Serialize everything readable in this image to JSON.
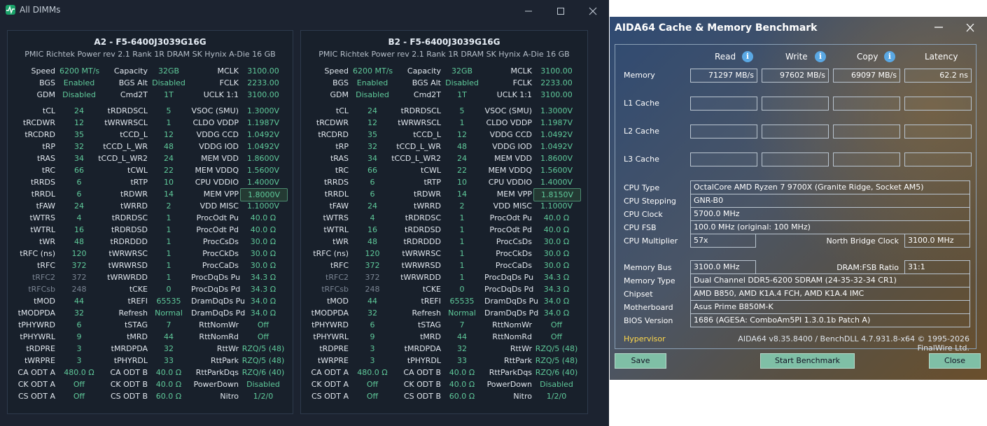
{
  "dimm_window": {
    "title": "All DIMMs",
    "controls": {
      "minimize": "—",
      "maximize": "☐",
      "close": "✕"
    },
    "panels": [
      {
        "title": "A2  -  F5-6400J3039G16G",
        "subtitle": "PMIC Richtek Power rev 2.1    Rank 1R    DRAM SK Hynix A-Die    16 GB",
        "rows": [
          [
            "Speed",
            "6200 MT/s",
            "Capacity",
            "32GB",
            "MCLK",
            "3100.00"
          ],
          [
            "BGS",
            "Enabled",
            "BGS Alt",
            "Disabled",
            "FCLK",
            "2233.00"
          ],
          [
            "GDM",
            "Disabled",
            "Cmd2T",
            "1T",
            "UCLK  1:1",
            "3100.00"
          ],
          [
            "tCL",
            "24",
            "tRDRDSCL",
            "5",
            "VSOC (SMU)",
            "1.3000V"
          ],
          [
            "tRCDWR",
            "12",
            "tWRWRSCL",
            "1",
            "CLDO VDDP",
            "1.1987V"
          ],
          [
            "tRCDRD",
            "35",
            "tCCD_L",
            "12",
            "VDDG CCD",
            "1.0492V"
          ],
          [
            "tRP",
            "32",
            "tCCD_L_WR",
            "48",
            "VDDG IOD",
            "1.0492V"
          ],
          [
            "tRAS",
            "34",
            "tCCD_L_WR2",
            "24",
            "MEM VDD",
            "1.8600V"
          ],
          [
            "tRC",
            "66",
            "tCWL",
            "22",
            "MEM VDDQ",
            "1.5600V"
          ],
          [
            "tRRDS",
            "6",
            "tRTP",
            "10",
            "CPU VDDIO",
            "1.4000V"
          ],
          [
            "tRRDL",
            "6",
            "tRDWR",
            "14",
            "MEM VPP",
            "1.8000V"
          ],
          [
            "tFAW",
            "24",
            "tWRRD",
            "2",
            "VDD MISC",
            "1.1000V"
          ],
          [
            "tWTRS",
            "4",
            "tRDRDSC",
            "1",
            "ProcOdt Pu",
            "40.0 Ω"
          ],
          [
            "tWTRL",
            "16",
            "tRDRDSD",
            "1",
            "ProcOdt Pd",
            "40.0 Ω"
          ],
          [
            "tWR",
            "48",
            "tRDRDDD",
            "1",
            "ProcCsDs",
            "30.0 Ω"
          ],
          [
            "tRFC (ns)",
            "120",
            "tWRWRSC",
            "1",
            "ProcCkDs",
            "30.0 Ω"
          ],
          [
            "tRFC",
            "372",
            "tWRWRSD",
            "1",
            "ProcCaDs",
            "30.0 Ω"
          ],
          [
            "tRFC2",
            "372",
            "tWRWRDD",
            "1",
            "ProcDqDs Pu",
            "34.3 Ω"
          ],
          [
            "tRFCsb",
            "248",
            "tCKE",
            "0",
            "ProcDqDs Pd",
            "34.3 Ω"
          ],
          [
            "tMOD",
            "44",
            "tREFI",
            "65535",
            "DramDqDs Pu",
            "34.0 Ω"
          ],
          [
            "tMODPDA",
            "32",
            "Refresh",
            "Normal",
            "DramDqDs Pd",
            "34.0 Ω"
          ],
          [
            "tPHYWRD",
            "6",
            "tSTAG",
            "7",
            "RttNomWr",
            "Off"
          ],
          [
            "tPHYWRL",
            "9",
            "tMRD",
            "44",
            "RttNomRd",
            "Off"
          ],
          [
            "tRDPRE",
            "3",
            "tMRDPDA",
            "32",
            "RttWr",
            "RZQ/5 (48)"
          ],
          [
            "tWRPRE",
            "3",
            "tPHYRDL",
            "33",
            "RttPark",
            "RZQ/5 (48)"
          ],
          [
            "CA ODT A",
            "480.0 Ω",
            "CA ODT B",
            "40.0 Ω",
            "RttParkDqs",
            "RZQ/6 (40)"
          ],
          [
            "CK ODT A",
            "Off",
            "CK ODT B",
            "40.0 Ω",
            "PowerDown",
            "Disabled"
          ],
          [
            "CS ODT A",
            "Off",
            "CS ODT B",
            "60.0 Ω",
            "Nitro",
            "1/2/0"
          ]
        ]
      },
      {
        "title": "B2  -  F5-6400J3039G16G",
        "subtitle": "PMIC Richtek Power rev 2.1    Rank 1R    DRAM SK Hynix A-Die    16 GB",
        "rows": [
          [
            "Speed",
            "6200 MT/s",
            "Capacity",
            "32GB",
            "MCLK",
            "3100.00"
          ],
          [
            "BGS",
            "Enabled",
            "BGS Alt",
            "Disabled",
            "FCLK",
            "2233.00"
          ],
          [
            "GDM",
            "Disabled",
            "Cmd2T",
            "1T",
            "UCLK  1:1",
            "3100.00"
          ],
          [
            "tCL",
            "24",
            "tRDRDSCL",
            "5",
            "VSOC (SMU)",
            "1.3000V"
          ],
          [
            "tRCDWR",
            "12",
            "tWRWRSCL",
            "1",
            "CLDO VDDP",
            "1.1987V"
          ],
          [
            "tRCDRD",
            "35",
            "tCCD_L",
            "12",
            "VDDG CCD",
            "1.0492V"
          ],
          [
            "tRP",
            "32",
            "tCCD_L_WR",
            "48",
            "VDDG IOD",
            "1.0492V"
          ],
          [
            "tRAS",
            "34",
            "tCCD_L_WR2",
            "24",
            "MEM VDD",
            "1.8600V"
          ],
          [
            "tRC",
            "66",
            "tCWL",
            "22",
            "MEM VDDQ",
            "1.5600V"
          ],
          [
            "tRRDS",
            "6",
            "tRTP",
            "10",
            "CPU VDDIO",
            "1.4000V"
          ],
          [
            "tRRDL",
            "6",
            "tRDWR",
            "14",
            "MEM VPP",
            "1.8150V"
          ],
          [
            "tFAW",
            "24",
            "tWRRD",
            "2",
            "VDD MISC",
            "1.1000V"
          ],
          [
            "tWTRS",
            "4",
            "tRDRDSC",
            "1",
            "ProcOdt Pu",
            "40.0 Ω"
          ],
          [
            "tWTRL",
            "16",
            "tRDRDSD",
            "1",
            "ProcOdt Pd",
            "40.0 Ω"
          ],
          [
            "tWR",
            "48",
            "tRDRDDD",
            "1",
            "ProcCsDs",
            "30.0 Ω"
          ],
          [
            "tRFC (ns)",
            "120",
            "tWRWRSC",
            "1",
            "ProcCkDs",
            "30.0 Ω"
          ],
          [
            "tRFC",
            "372",
            "tWRWRSD",
            "1",
            "ProcCaDs",
            "30.0 Ω"
          ],
          [
            "tRFC2",
            "372",
            "tWRWRDD",
            "1",
            "ProcDqDs Pu",
            "34.3 Ω"
          ],
          [
            "tRFCsb",
            "248",
            "tCKE",
            "0",
            "ProcDqDs Pd",
            "34.3 Ω"
          ],
          [
            "tMOD",
            "44",
            "tREFI",
            "65535",
            "DramDqDs Pu",
            "34.0 Ω"
          ],
          [
            "tMODPDA",
            "32",
            "Refresh",
            "Normal",
            "DramDqDs Pd",
            "34.0 Ω"
          ],
          [
            "tPHYWRD",
            "6",
            "tSTAG",
            "7",
            "RttNomWr",
            "Off"
          ],
          [
            "tPHYWRL",
            "9",
            "tMRD",
            "44",
            "RttNomRd",
            "Off"
          ],
          [
            "tRDPRE",
            "3",
            "tMRDPDA",
            "32",
            "RttWr",
            "RZQ/5 (48)"
          ],
          [
            "tWRPRE",
            "3",
            "tPHYRDL",
            "33",
            "RttPark",
            "RZQ/5 (48)"
          ],
          [
            "CA ODT A",
            "480.0 Ω",
            "CA ODT B",
            "40.0 Ω",
            "RttParkDqs",
            "RZQ/6 (40)"
          ],
          [
            "CK ODT A",
            "Off",
            "CK ODT B",
            "40.0 Ω",
            "PowerDown",
            "Disabled"
          ],
          [
            "CS ODT A",
            "Off",
            "CS ODT B",
            "60.0 Ω",
            "Nitro",
            "1/2/0"
          ]
        ]
      }
    ],
    "dimmed_labels": [
      "tRFC2",
      "tRFCsb"
    ],
    "highlighted_label": "MEM VPP",
    "colors": {
      "bg": "#1c2330",
      "label": "#e1e7ee",
      "value": "#5fc99a",
      "dimmed": "#7a8492"
    }
  },
  "aida": {
    "title": "AIDA64 Cache & Memory Benchmark",
    "controls": {
      "minimize": "—",
      "close": "✕"
    },
    "headers": {
      "read": "Read",
      "write": "Write",
      "copy": "Copy",
      "latency": "Latency",
      "info_glyph": "i"
    },
    "rows": {
      "memory": {
        "label": "Memory",
        "read": "71297 MB/s",
        "write": "97602 MB/s",
        "copy": "69097 MB/s",
        "latency": "62.2 ns"
      },
      "l1": {
        "label": "L1 Cache"
      },
      "l2": {
        "label": "L2 Cache"
      },
      "l3": {
        "label": "L3 Cache"
      }
    },
    "info": {
      "cpu_type": {
        "label": "CPU Type",
        "value": "OctalCore AMD Ryzen 7 9700X  (Granite Ridge, Socket AM5)"
      },
      "cpu_stepping": {
        "label": "CPU Stepping",
        "value": "GNR-B0"
      },
      "cpu_clock": {
        "label": "CPU Clock",
        "value": "5700.0 MHz"
      },
      "cpu_fsb": {
        "label": "CPU FSB",
        "value": "100.0 MHz  (original: 100 MHz)"
      },
      "cpu_multiplier": {
        "label": "CPU Multiplier",
        "value": "57x"
      },
      "nb_clock": {
        "label": "North Bridge Clock",
        "value": "3100.0 MHz"
      },
      "memory_bus": {
        "label": "Memory Bus",
        "value": "3100.0 MHz"
      },
      "dram_fsb": {
        "label": "DRAM:FSB Ratio",
        "value": "31:1"
      },
      "memory_type": {
        "label": "Memory Type",
        "value": "Dual Channel DDR5-6200 SDRAM  (24-35-32-34 CR1)"
      },
      "chipset": {
        "label": "Chipset",
        "value": "AMD B850, AMD K1A.4 FCH, AMD K1A.4 IMC"
      },
      "motherboard": {
        "label": "Motherboard",
        "value": "Asus Prime B850M-K"
      },
      "bios": {
        "label": "BIOS Version",
        "value": "1686  (AGESA: ComboAm5PI 1.3.0.1b Patch A)"
      }
    },
    "hypervisor": "Hypervisor",
    "footer": "AIDA64 v8.35.8400 / BenchDLL 4.7.931.8-x64 © 1995-2026 FinalWire Ltd.",
    "buttons": {
      "save": "Save",
      "start": "Start Benchmark",
      "close": "Close"
    },
    "colors": {
      "hypervisor": "#ffd84a",
      "button": "#7fbfa6"
    }
  }
}
